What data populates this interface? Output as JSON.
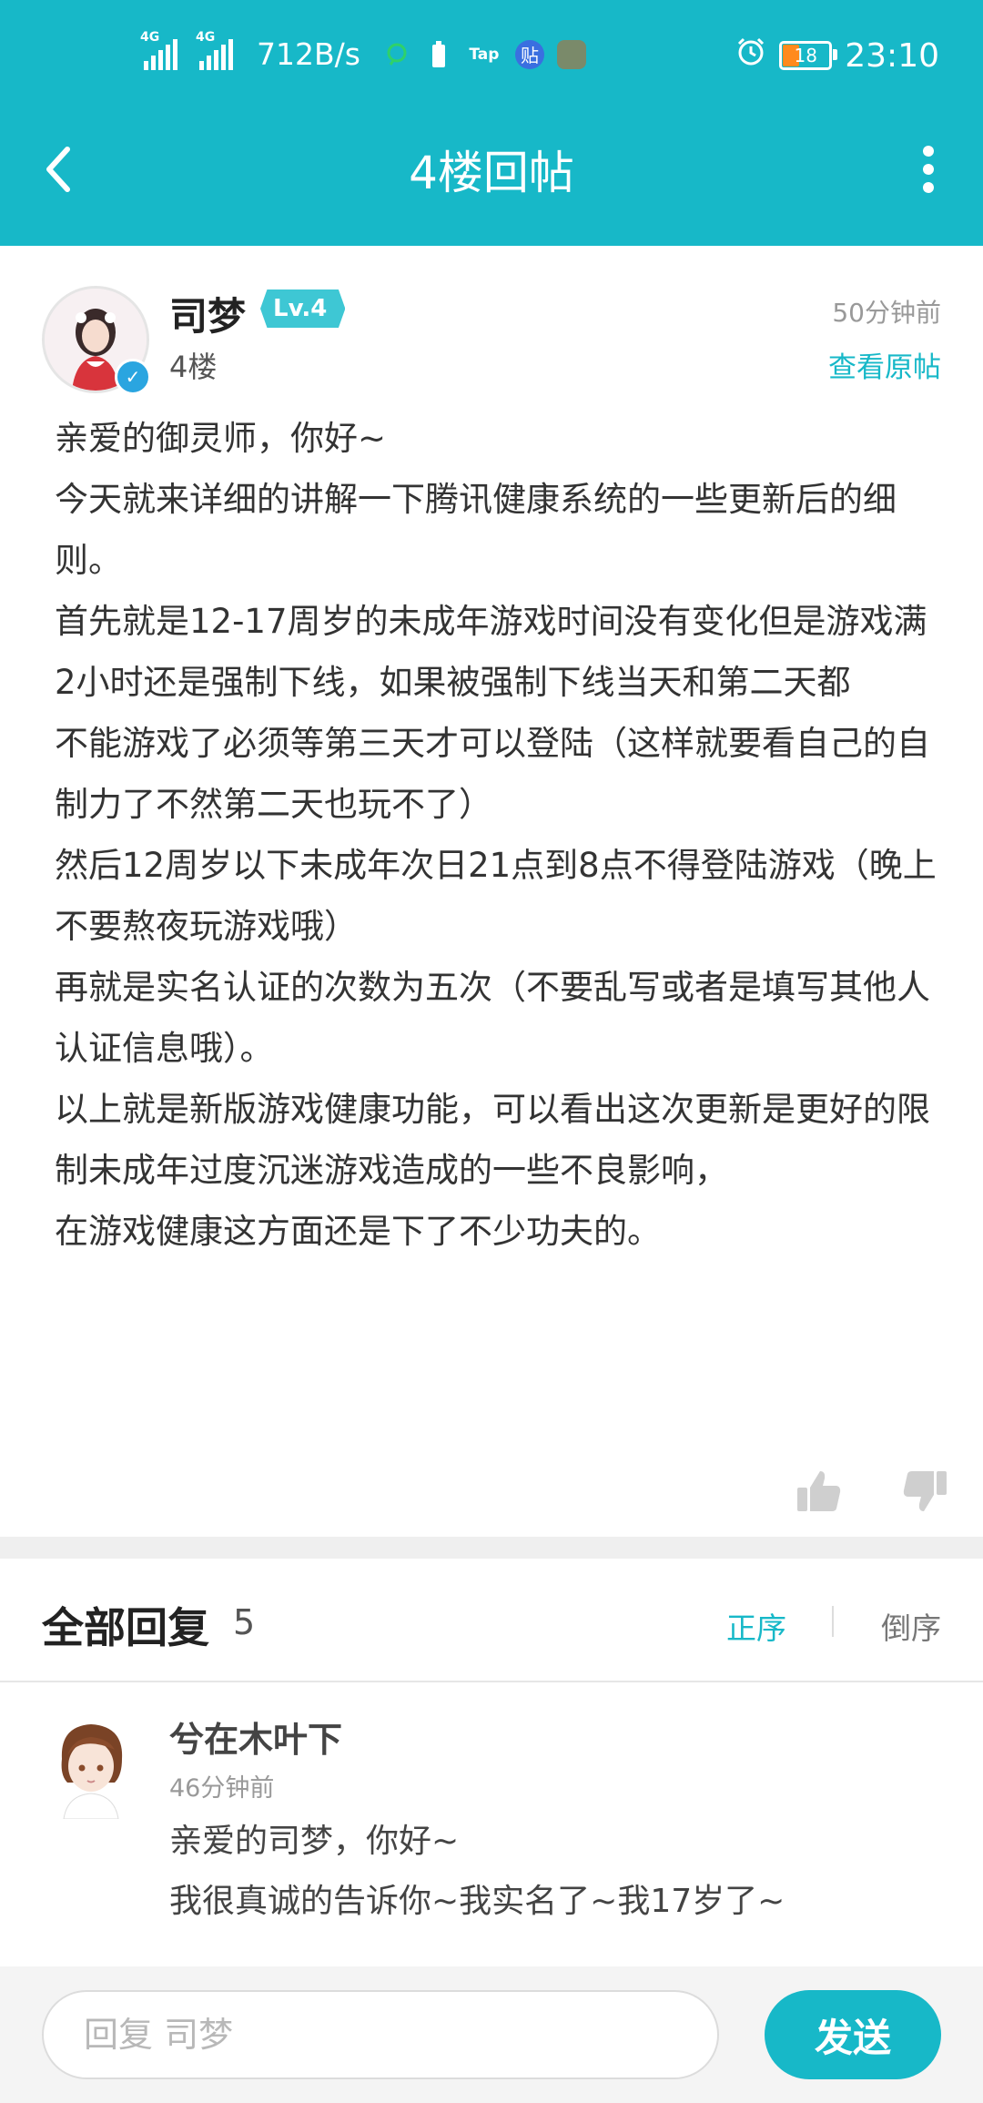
{
  "status_bar": {
    "net1": "4G",
    "net2": "4G",
    "speed": "712B/s",
    "tap_label": "Tap",
    "tieba_label": "贴",
    "battery": "18",
    "time": "23:10"
  },
  "header": {
    "title": "4楼回帖",
    "back_icon": "chevron-left-icon",
    "more_icon": "more-vertical-icon",
    "color": "#17b8c8"
  },
  "post": {
    "author": "司梦",
    "level": "Lv.4",
    "floor": "4楼",
    "time": "50分钟前",
    "view_original": "查看原帖",
    "lines": [
      "亲爱的御灵师，你好~",
      "今天就来详细的讲解一下腾讯健康系统的一些更新后的细则。",
      "首先就是12-17周岁的未成年游戏时间没有变化但是游戏满2小时还是强制下线，如果被强制下线当天和第二天都",
      "不能游戏了必须等第三天才可以登陆（这样就要看自己的自制力了不然第二天也玩不了）",
      "然后12周岁以下未成年次日21点到8点不得登陆游戏（晚上不要熬夜玩游戏哦）",
      "再就是实名认证的次数为五次（不要乱写或者是填写其他人认证信息哦）。",
      "以上就是新版游戏健康功能，可以看出这次更新是更好的限制未成年过度沉迷游戏造成的一些不良影响，",
      "在游戏健康这方面还是下了不少功夫的。"
    ]
  },
  "replies": {
    "title": "全部回复",
    "count": "5",
    "sort_asc": "正序",
    "sort_desc": "倒序",
    "items": [
      {
        "name": "兮在木叶下",
        "time": "46分钟前",
        "lines": [
          "亲爱的司梦，你好~",
          "我很真诚的告诉你~我实名了~我17岁了~"
        ]
      }
    ]
  },
  "composer": {
    "placeholder": "回复 司梦",
    "send": "发送"
  }
}
